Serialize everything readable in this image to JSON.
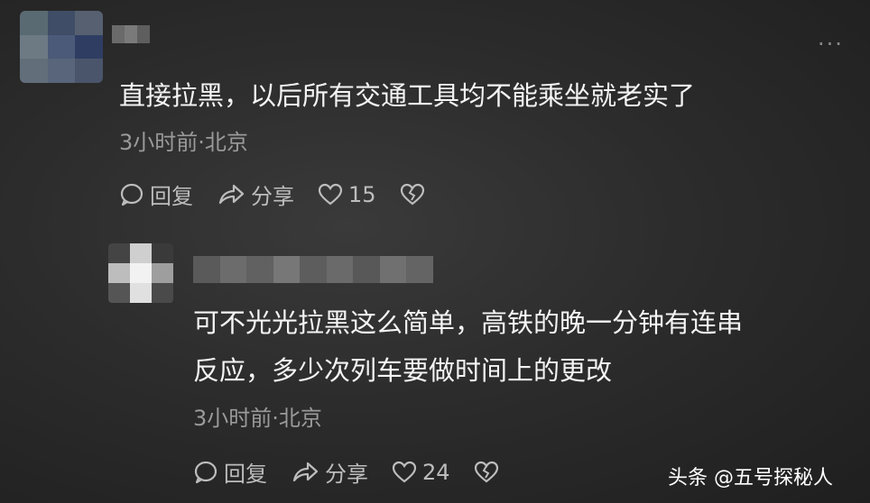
{
  "comments": [
    {
      "text": "直接拉黑，以后所有交通工具均不能乘坐就老实了",
      "meta": "3小时前·北京",
      "reply_label": "回复",
      "share_label": "分享",
      "like_count": "15"
    },
    {
      "text_line1": "可不光光拉黑这么简单，高铁的晚一分钟有连串",
      "text_line2": "反应，多少次列车要做时间上的更改",
      "meta": "3小时前·北京",
      "reply_label": "回复",
      "share_label": "分享",
      "like_count": "24"
    }
  ],
  "more_menu_glyph": "···",
  "watermark": "头条 @五号探秘人",
  "icons": [
    "more-icon",
    "reply-icon",
    "share-icon",
    "like-icon",
    "dislike-icon"
  ],
  "colors": {
    "background": "#2c2c2c",
    "text": "#f4f4f4",
    "meta_text": "#9a9a9a",
    "action_text": "#bdbdbd"
  }
}
